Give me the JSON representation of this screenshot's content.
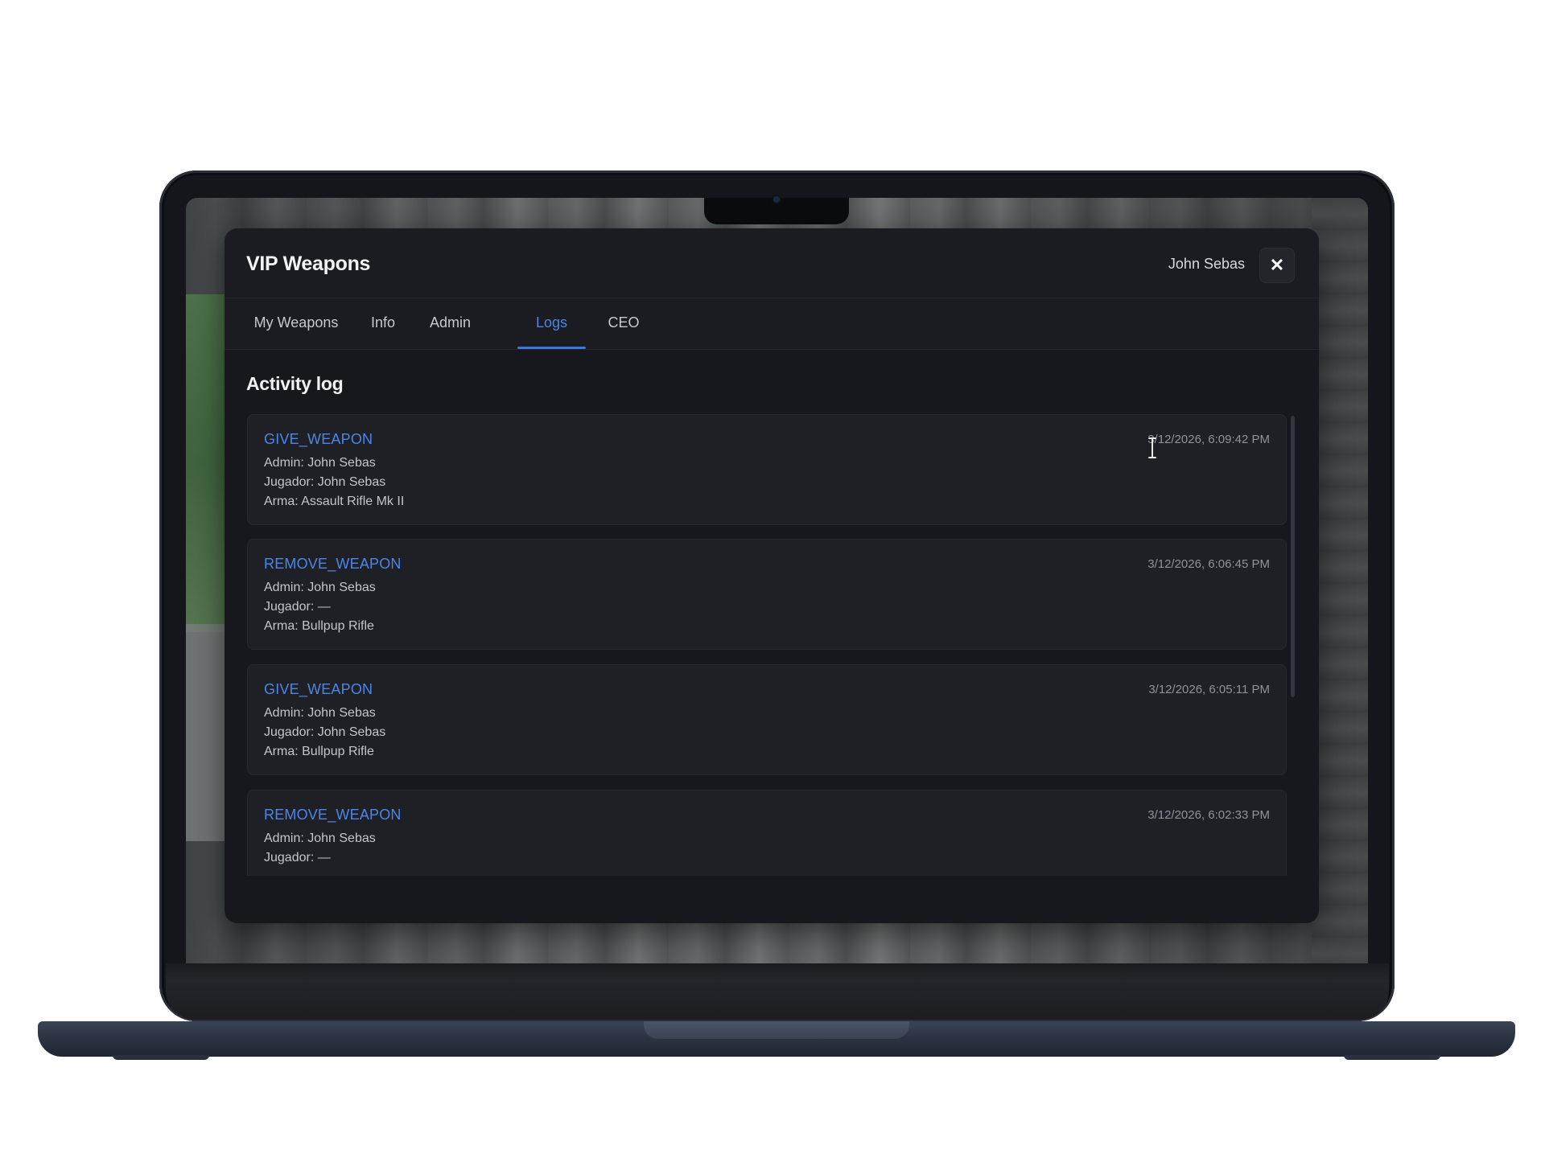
{
  "app": {
    "title": "VIP Weapons",
    "user_name": "John Sebas",
    "close_symbol": "✕"
  },
  "tabs": [
    {
      "label": "My Weapons",
      "active": false
    },
    {
      "label": "Info",
      "active": false
    },
    {
      "label": "Admin",
      "active": false
    },
    {
      "label": "Logs",
      "active": true
    },
    {
      "label": "CEO",
      "active": false
    }
  ],
  "logs": {
    "section_title": "Activity log",
    "entries": [
      {
        "action": "GIVE_WEAPON",
        "timestamp": "3/12/2026, 6:09:42 PM",
        "admin": "Admin: John Sebas",
        "player": "Jugador: John Sebas",
        "weapon": "Arma: Assault Rifle Mk II"
      },
      {
        "action": "REMOVE_WEAPON",
        "timestamp": "3/12/2026, 6:06:45 PM",
        "admin": "Admin: John Sebas",
        "player": "Jugador: —",
        "weapon": "Arma: Bullpup Rifle"
      },
      {
        "action": "GIVE_WEAPON",
        "timestamp": "3/12/2026, 6:05:11 PM",
        "admin": "Admin: John Sebas",
        "player": "Jugador: John Sebas",
        "weapon": "Arma: Bullpup Rifle"
      },
      {
        "action": "REMOVE_WEAPON",
        "timestamp": "3/12/2026, 6:02:33 PM",
        "admin": "Admin: John Sebas",
        "player": "Jugador: —",
        "weapon": ""
      }
    ]
  },
  "colors": {
    "accent": "#3a78e0",
    "panel_bg": "#17181d",
    "card_bg": "#1f2026",
    "action_text": "#4a86e8"
  },
  "icons": {
    "close": "close-icon",
    "cursor": "text-cursor-icon"
  }
}
